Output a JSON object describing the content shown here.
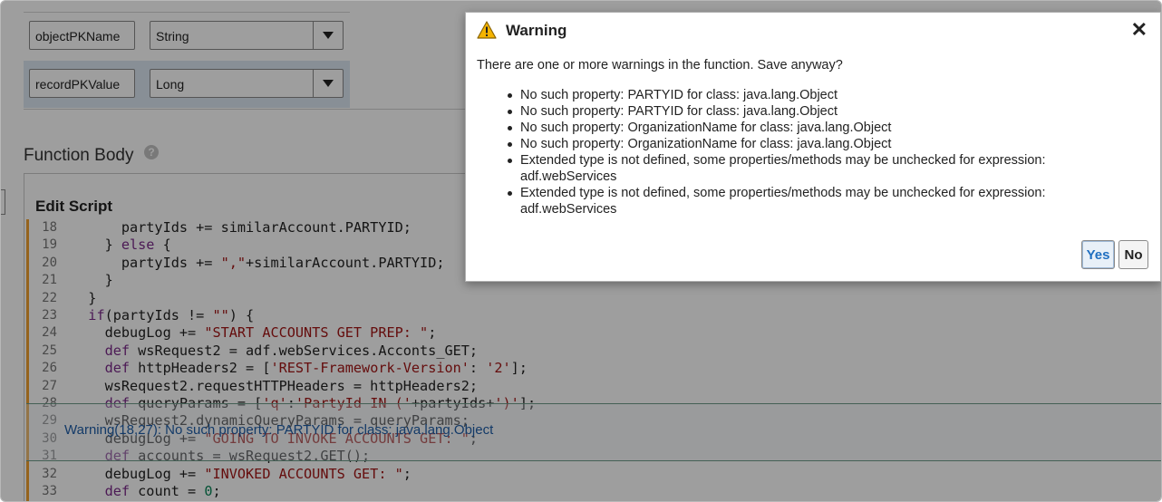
{
  "params": [
    {
      "name": "objectPKName",
      "type": "String"
    },
    {
      "name": "recordPKValue",
      "type": "Long"
    }
  ],
  "function_body": {
    "title": "Function Body",
    "help": "?",
    "edit_label": "Edit Script"
  },
  "code_lines": [
    {
      "n": "18",
      "src": "      partyIds += similarAccount.PARTYID;"
    },
    {
      "n": "19",
      "src": "    } else {"
    },
    {
      "n": "20",
      "src": "      partyIds += \",\"+similarAccount.PARTYID;"
    },
    {
      "n": "21",
      "src": "    }"
    },
    {
      "n": "22",
      "src": "  }"
    },
    {
      "n": "23",
      "src": "  if(partyIds != \"\") {"
    },
    {
      "n": "24",
      "src": "    debugLog += \"START ACCOUNTS GET PREP: \";"
    },
    {
      "n": "25",
      "src": "    def wsRequest2 = adf.webServices.Acconts_GET;"
    },
    {
      "n": "26",
      "src": "    def httpHeaders2 = ['REST-Framework-Version': '2'];"
    },
    {
      "n": "27",
      "src": "    wsRequest2.requestHTTPHeaders = httpHeaders2;"
    },
    {
      "n": "28",
      "src": "    def queryParams = ['q':'PartyId IN ('+partyIds+')'];"
    },
    {
      "n": "29",
      "src": "    wsRequest2.dynamicQueryParams = queryParams;"
    },
    {
      "n": "30",
      "src": "    debugLog += \"GOING TO INVOKE ACCOUNTS GET: \";"
    },
    {
      "n": "31",
      "src": "    def accounts = wsRequest2.GET();"
    },
    {
      "n": "32",
      "src": "    debugLog += \"INVOKED ACCOUNTS GET: \";"
    },
    {
      "n": "33",
      "src": "    def count = 0;"
    }
  ],
  "inline_warning": "Warning(18,27): No such property: PARTYID for class: java.lang.Object",
  "dialog": {
    "title": "Warning",
    "close": "✕",
    "message": "There are one or more warnings in the function. Save anyway?",
    "warnings": [
      "No such property: PARTYID for class: java.lang.Object",
      "No such property: PARTYID for class: java.lang.Object",
      "No such property: OrganizationName for class: java.lang.Object",
      "No such property: OrganizationName for class: java.lang.Object",
      "Extended type is not defined, some properties/methods may be unchecked for expression: adf.webServices",
      "Extended type is not defined, some properties/methods may be unchecked for expression: adf.webServices"
    ],
    "yes_label": "Yes",
    "no_label": "No"
  },
  "colors": {
    "accent_blue": "#1f6fc0",
    "selected_row": "#dbe7f3",
    "warning_gutter": "#f0a030",
    "string": "#a31515",
    "keyword": "#7b2a8a"
  },
  "icons": {
    "warning": "warning-triangle-icon",
    "close": "close-icon",
    "help": "help-icon",
    "dropdown": "chevron-down-icon"
  }
}
